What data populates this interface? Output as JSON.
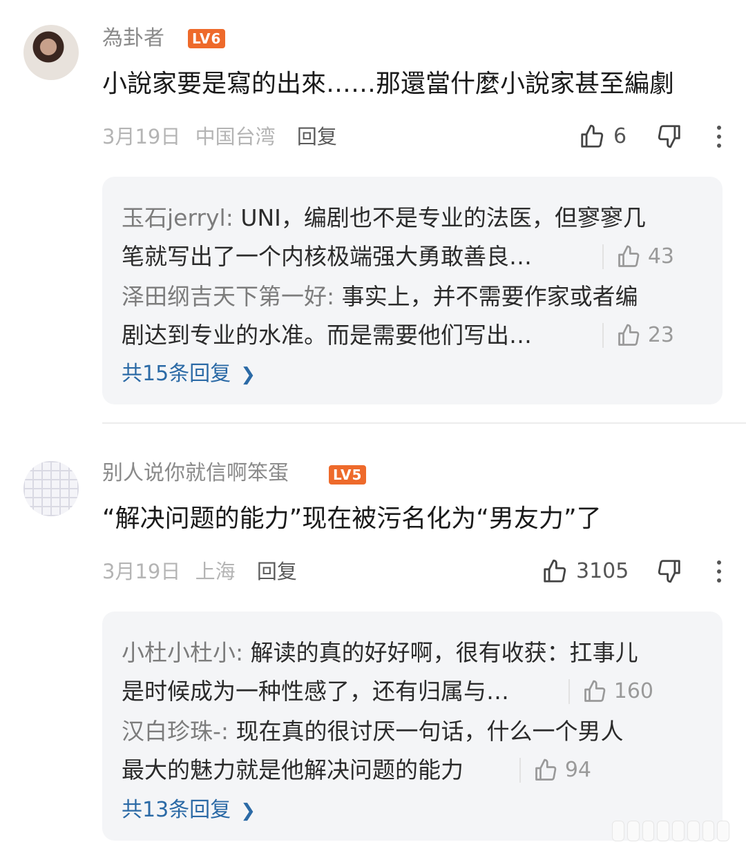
{
  "comments": [
    {
      "username": "為卦者",
      "level": "LV6",
      "content": "小說家要是寫的出來……那還當什麼小說家甚至編劇",
      "date": "3月19日",
      "location": "中国台湾",
      "reply_label": "回复",
      "likes": "6",
      "replies": [
        {
          "name": "玉石jerryl",
          "line1": "UNI，编剧也不是专业的法医，但寥寥几",
          "line2": "笔就写出了一个内核极端强大勇敢善良…",
          "likes": "43"
        },
        {
          "name": "泽田纲吉天下第一好",
          "line1": "事实上，并不需要作家或者编",
          "line2": "剧达到专业的水准。而是需要他们写出…",
          "likes": "23"
        }
      ],
      "total_replies": "共15条回复"
    },
    {
      "username": "别人说你就信啊笨蛋",
      "level": "LV5",
      "content": "“解决问题的能力”现在被污名化为“男友力”了",
      "date": "3月19日",
      "location": "上海",
      "reply_label": "回复",
      "likes": "3105",
      "replies": [
        {
          "name": "小杜小杜小",
          "line1": "解读的真的好好啊，很有收获：扛事儿",
          "line2": "是时候成为一种性感了，还有归属与…",
          "likes": "160"
        },
        {
          "name": "汉白珍珠-",
          "line1": "现在真的很讨厌一句话，什么一个男人",
          "line2": "最大的魅力就是他解决问题的能力",
          "likes": "94"
        }
      ],
      "total_replies": "共13条回复"
    }
  ],
  "colors": {
    "level_badge": "#ee6a2b",
    "link": "#2b6aa6",
    "reply_bg": "#f4f5f7"
  },
  "icons": [
    "thumbs-up-icon",
    "thumbs-down-icon",
    "more-vertical-icon",
    "chevron-right-icon"
  ]
}
